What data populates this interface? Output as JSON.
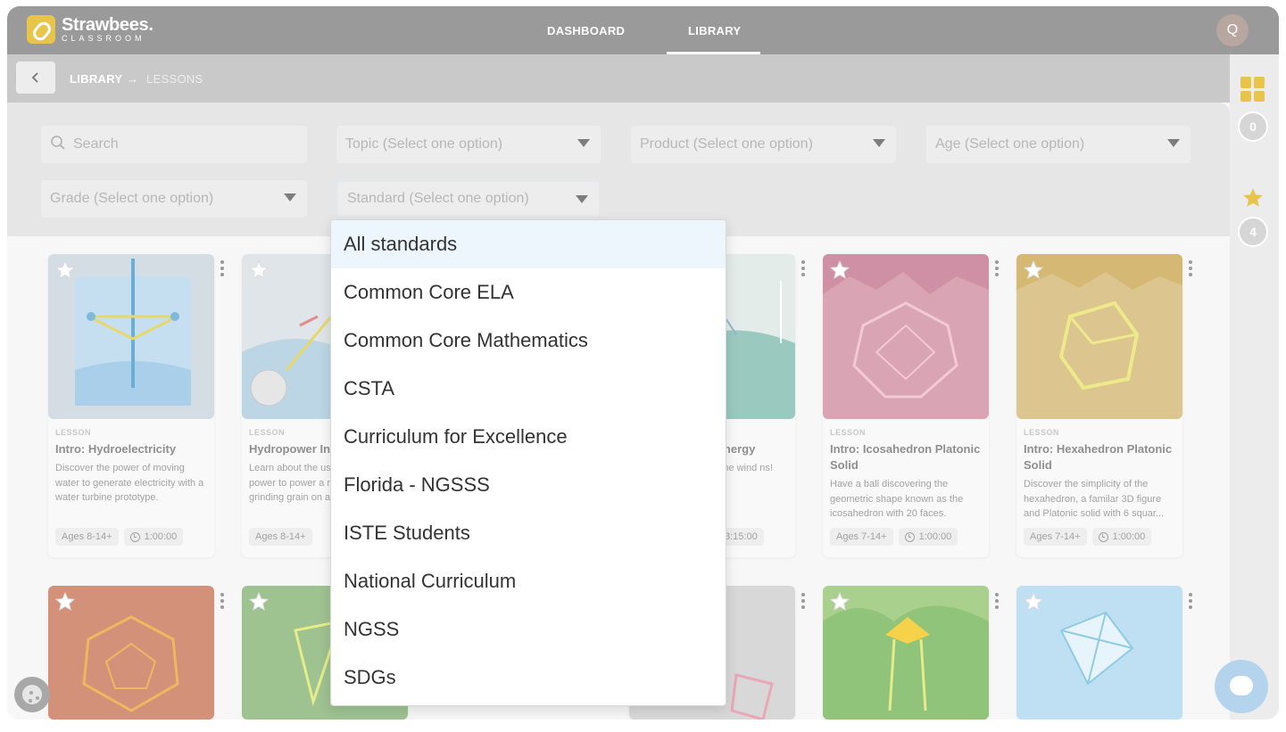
{
  "brand": {
    "name": "Strawbees.",
    "subtitle": "CLASSROOM"
  },
  "nav": {
    "dashboard": "DASHBOARD",
    "library": "LIBRARY",
    "avatar_initial": "Q"
  },
  "breadcrumb": {
    "library": "LIBRARY",
    "separator": "→",
    "current": "LESSONS"
  },
  "filters": {
    "search_placeholder": "Search",
    "topic": "Topic (Select one option)",
    "product": "Product (Select one option)",
    "age": "Age (Select one option)",
    "grade": "Grade (Select one option)",
    "standard": "Standard (Select one option)"
  },
  "rail": {
    "saved_count": "0",
    "favorites_count": "4"
  },
  "standards_dropdown": {
    "options": [
      "All standards",
      "Common Core ELA",
      "Common Core Mathematics",
      "CSTA",
      "Curriculum for Excellence",
      "Florida - NGSSS",
      "ISTE Students",
      "National Curriculum",
      "NGSS",
      "SDGs"
    ],
    "highlighted": "All standards"
  },
  "cards": [
    {
      "label": "LESSON",
      "title": "Intro: Hydroelectricity",
      "desc": "Discover the power of moving water to generate electricity with a water turbine prototype.",
      "age": "Ages 8-14+",
      "duration": "1:00:00",
      "bg": "#cfd8de"
    },
    {
      "label": "LESSON",
      "title": "Hydropower In",
      "desc": "Learn about the us power to power a r grinding grain on a",
      "age": "Ages 8-14+",
      "duration": "",
      "bg": "#c7d4d9"
    },
    {
      "label": "",
      "title": "l Energy",
      "desc": "of the wind ns!",
      "age": "",
      "duration": "3:15:00",
      "bg": "#cfe0dc"
    },
    {
      "label": "LESSON",
      "title": "Intro: Icosahedron Platonic Solid",
      "desc": "Have a ball discovering the geometric shape known as the icosahedron with 20 faces.",
      "age": "Ages 7-14+",
      "duration": "1:00:00",
      "bg": "#d7a5b4"
    },
    {
      "label": "LESSON",
      "title": "Intro: Hexahedron Platonic Solid",
      "desc": "Discover the simplicity of the hexahedron, a familar 3D figure and Platonic solid with 6 squar...",
      "age": "Ages 7-14+",
      "duration": "1:00:00",
      "bg": "#dcc48a"
    }
  ],
  "colors": {
    "accent": "#e9c44a",
    "nav_bg": "#9a9a9a",
    "highlight": "#eef6fd"
  }
}
